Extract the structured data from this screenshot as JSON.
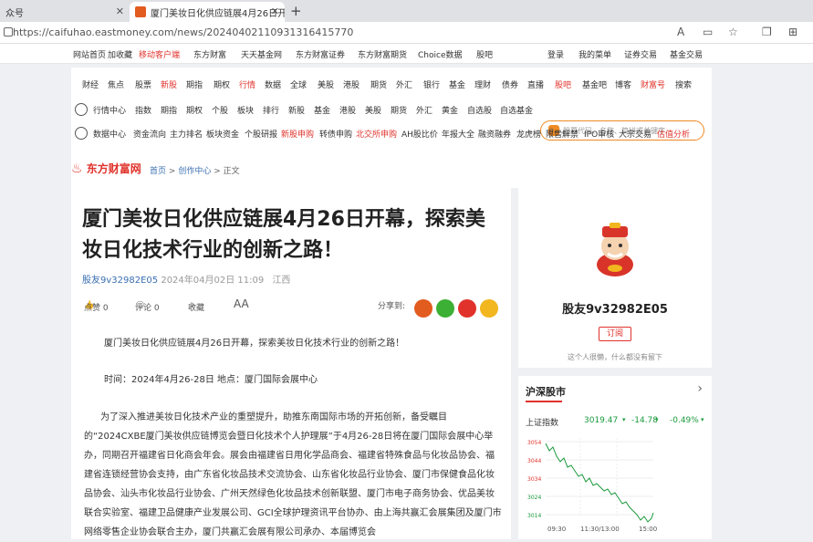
{
  "browser": {
    "tab1_title": "众号",
    "tab2_title": "厦门美妆日化供应链展4月26日开幕",
    "url": "https://caifuhao.eastmoney.com/news/20240402110931316415770"
  },
  "topnav": {
    "left": [
      "网站首页",
      "加收藏",
      "移动客户端",
      "东方财富",
      "天天基金网",
      "东方财富证券",
      "东方财富期货",
      "Choice数据",
      "股吧"
    ],
    "right": [
      "登录",
      "我的菜单",
      "证券交易",
      "基金交易"
    ]
  },
  "menu": {
    "row1": [
      "财经",
      "焦点",
      "股票",
      "新股",
      "期指",
      "期权",
      "行情",
      "数据",
      "全球",
      "美股",
      "港股",
      "期货",
      "外汇",
      "银行",
      "基金",
      "理财",
      "债券",
      "直播",
      "股吧",
      "基金吧",
      "博客",
      "财富号",
      "搜索"
    ],
    "row2_label": "行情中心",
    "row2": [
      "指数",
      "期指",
      "期权",
      "个股",
      "板块",
      "排行",
      "新股",
      "基金",
      "港股",
      "美股",
      "期货",
      "外汇",
      "黄金",
      "自选股",
      "自选基金"
    ],
    "row3_label": "数据中心",
    "row3": [
      "资金流向",
      "主力排名",
      "板块资金",
      "个股研报",
      "新股申购",
      "转债申购",
      "北交所申购",
      "AH股比价",
      "年报大全",
      "融资融券",
      "龙虎榜",
      "限售解禁",
      "IPO审核",
      "大宗交易",
      "估值分析"
    ],
    "search_placeholder": "输入股票代码、名称、简拼或关键字"
  },
  "breadcrumb": {
    "logo": "东方财富网",
    "home": "首页",
    "sep1": ">",
    "section": "创作中心",
    "sep2": ">",
    "current": "正文"
  },
  "article": {
    "title": "厦门美妆日化供应链展4月26日开幕，探索美妆日化技术行业的创新之路！",
    "author": "股友9v32982E05",
    "date": "2024年04月02日 11:09",
    "location": "江西",
    "like": "点赞 0",
    "comment": "评论 0",
    "collect": "收藏",
    "font_size": "AA",
    "share_label": "分享到:",
    "p1": "厦门美妆日化供应链展4月26日开幕，探索美妆日化技术行业的创新之路！",
    "p2": "时间：2024年4月26-28日 地点：厦门国际会展中心",
    "p3": "为了深入推进美妆日化技术产业的重塑提升，助推东南国际市场的开拓创新，备受瞩目的“2024CXBE厦门美妆供应链博览会暨日化技术个人护理展”于4月26-28日将在厦门国际会展中心举办，同期召开福建省日化商会年会。展会由福建省日用化学品商会、福建省特殊食品与化妆品协会、福建省连锁经营协会支持，由广东省化妆品技术交流协会、山东省化妆品行业协会、厦门市保健食品化妆品协会、汕头市化妆品行业协会、广州天然绿色化妆品技术创新联盟、厦门市电子商务协会、优品美妆联合实验室、福建卫品健康产业发展公司、GCI全球护理资讯平台协办、由上海共赢汇会展集团及厦门市网络零售企业协会联合主办，厦门共赢汇会展有限公司承办、本届博览会"
  },
  "profile": {
    "name": "股友9v32982E05",
    "subscribe": "订阅",
    "signature": "这个人很懒，什么都没有留下"
  },
  "market": {
    "title": "沪深股市",
    "index_name": "上证指数",
    "index_value": "3019.47",
    "change": "-14.78",
    "change_pct": "-0.49%",
    "x_labels": [
      "09:30",
      "11:30/13:00",
      "15:00"
    ],
    "y_labels": [
      "3054",
      "3044",
      "3034",
      "3024",
      "3014"
    ]
  },
  "colors": {
    "brand_red": "#e0322b",
    "down_green": "#1a9a3c",
    "link_blue": "#3a6fb0"
  }
}
